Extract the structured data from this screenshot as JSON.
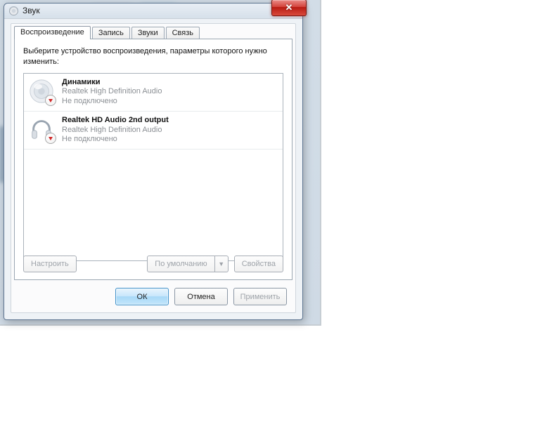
{
  "window": {
    "title": "Звук"
  },
  "tabs": [
    {
      "label": "Воспроизведение"
    },
    {
      "label": "Запись"
    },
    {
      "label": "Звуки"
    },
    {
      "label": "Связь"
    }
  ],
  "instruction": "Выберите устройство воспроизведения, параметры которого нужно изменить:",
  "devices": [
    {
      "name": "Динамики",
      "driver": "Realtek High Definition Audio",
      "status": "Не подключено"
    },
    {
      "name": "Realtek HD Audio 2nd output",
      "driver": "Realtek High Definition Audio",
      "status": "Не подключено"
    }
  ],
  "panel_buttons": {
    "configure": "Настроить",
    "default": "По умолчанию",
    "properties": "Свойства"
  },
  "dialog_buttons": {
    "ok": "ОК",
    "cancel": "Отмена",
    "apply": "Применить"
  }
}
